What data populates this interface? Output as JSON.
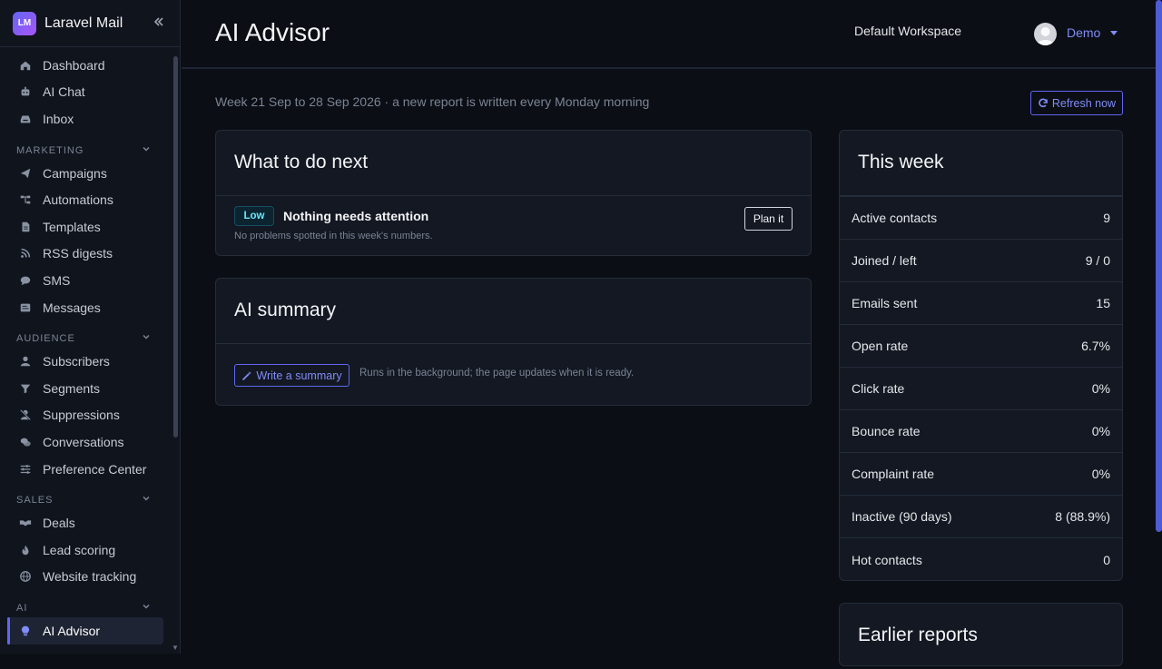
{
  "app": {
    "logo": "LM",
    "name": "Laravel Mail"
  },
  "sidebar": {
    "top": [
      {
        "label": "Dashboard",
        "icon": "home-icon"
      },
      {
        "label": "AI Chat",
        "icon": "robot-icon"
      },
      {
        "label": "Inbox",
        "icon": "inbox-icon"
      }
    ],
    "sections": [
      {
        "title": "MARKETING",
        "items": [
          {
            "label": "Campaigns",
            "icon": "paper-plane-icon"
          },
          {
            "label": "Automations",
            "icon": "sitemap-icon"
          },
          {
            "label": "Templates",
            "icon": "file-icon"
          },
          {
            "label": "RSS digests",
            "icon": "rss-icon"
          },
          {
            "label": "SMS",
            "icon": "sms-icon"
          },
          {
            "label": "Messages",
            "icon": "messages-icon"
          }
        ]
      },
      {
        "title": "AUDIENCE",
        "items": [
          {
            "label": "Subscribers",
            "icon": "user-icon"
          },
          {
            "label": "Segments",
            "icon": "filter-icon"
          },
          {
            "label": "Suppressions",
            "icon": "user-slash-icon"
          },
          {
            "label": "Conversations",
            "icon": "comments-icon"
          },
          {
            "label": "Preference Center",
            "icon": "sliders-icon"
          }
        ]
      },
      {
        "title": "SALES",
        "items": [
          {
            "label": "Deals",
            "icon": "handshake-icon"
          },
          {
            "label": "Lead scoring",
            "icon": "fire-icon"
          },
          {
            "label": "Website tracking",
            "icon": "globe-icon"
          }
        ]
      },
      {
        "title": "AI",
        "items": [
          {
            "label": "AI Advisor",
            "icon": "lightbulb-icon",
            "active": true
          }
        ]
      }
    ]
  },
  "header": {
    "title": "AI Advisor",
    "workspace": "Default Workspace",
    "user": "Demo"
  },
  "page": {
    "week_line": "Week 21 Sep to 28 Sep 2026 · a new report is written every Monday morning",
    "refresh_label": "Refresh now"
  },
  "next": {
    "title": "What to do next",
    "badge": "Low",
    "item_title": "Nothing needs attention",
    "item_sub": "No problems spotted in this week's numbers.",
    "button": "Plan it"
  },
  "summary": {
    "title": "AI summary",
    "button": "Write a summary",
    "note": "Runs in the background; the page updates when it is ready."
  },
  "week": {
    "title": "This week",
    "stats": [
      {
        "label": "Active contacts",
        "value": "9"
      },
      {
        "label": "Joined / left",
        "value": "9 / 0"
      },
      {
        "label": "Emails sent",
        "value": "15"
      },
      {
        "label": "Open rate",
        "value": "6.7%"
      },
      {
        "label": "Click rate",
        "value": "0%"
      },
      {
        "label": "Bounce rate",
        "value": "0%"
      },
      {
        "label": "Complaint rate",
        "value": "0%"
      },
      {
        "label": "Inactive (90 days)",
        "value": "8 (88.9%)"
      },
      {
        "label": "Hot contacts",
        "value": "0"
      }
    ]
  },
  "earlier": {
    "title": "Earlier reports"
  },
  "colors": {
    "accent": "#6366f1",
    "accent_text": "#818cf8",
    "badge_low": "#67e8f9"
  }
}
